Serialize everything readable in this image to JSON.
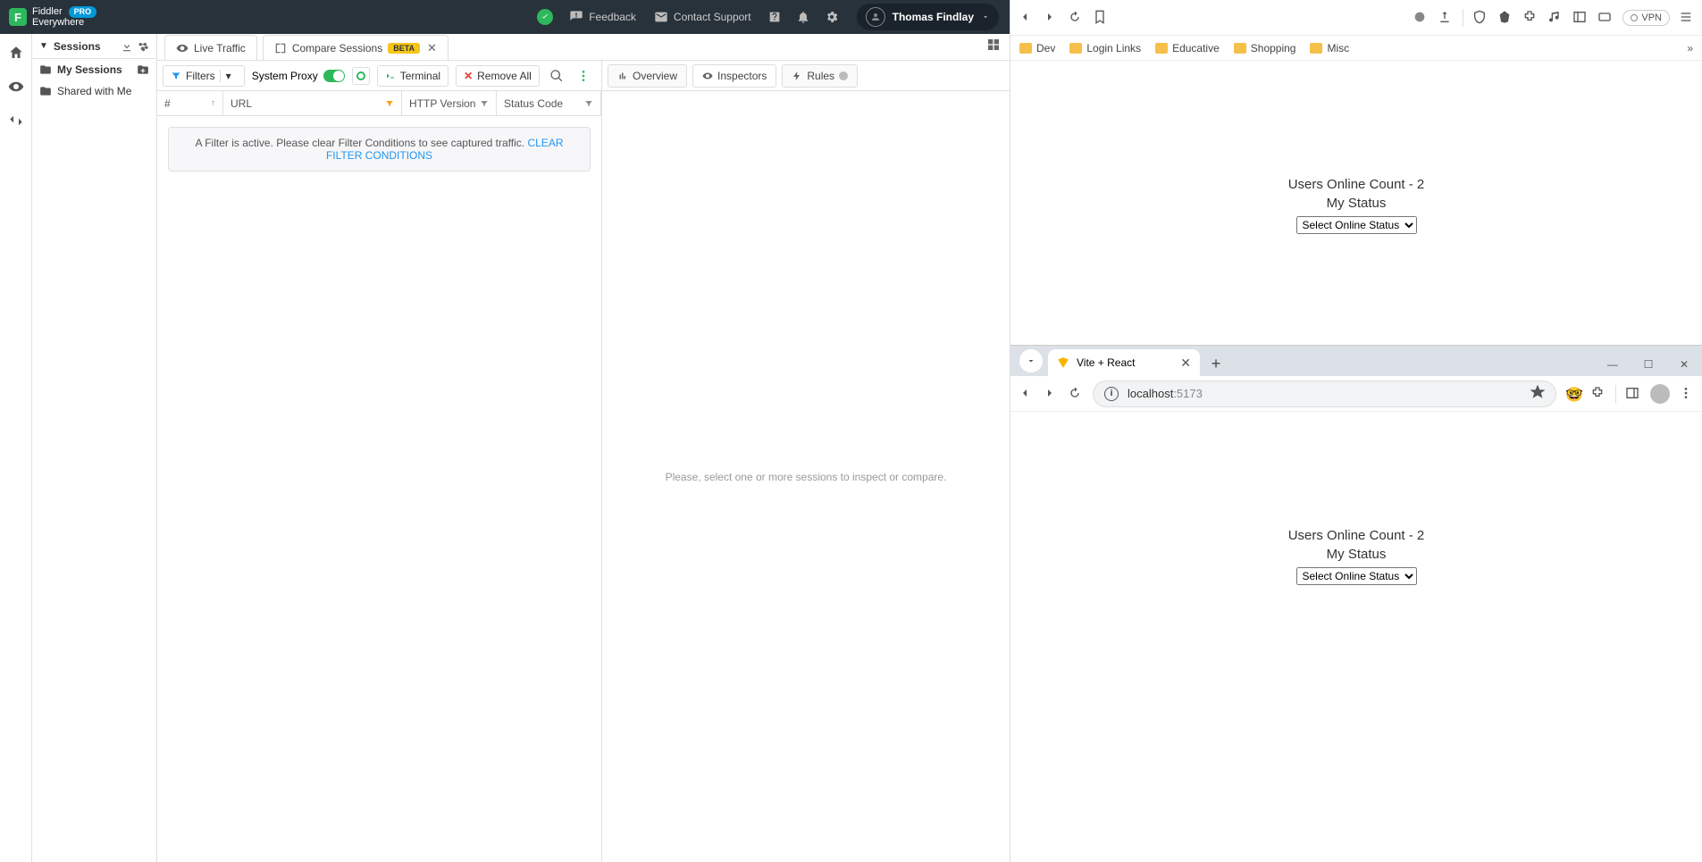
{
  "topbar": {
    "product_line1": "Fiddler",
    "product_line2": "Everywhere",
    "pro": "PRO",
    "feedback": "Feedback",
    "contact": "Contact Support",
    "user": "Thomas Findlay"
  },
  "sidebar": {
    "title": "Sessions",
    "my_sessions": "My Sessions",
    "shared": "Shared with Me"
  },
  "tabs": {
    "live": "Live Traffic",
    "compare": "Compare Sessions",
    "beta": "BETA"
  },
  "toolbar": {
    "filters": "Filters",
    "system_proxy": "System Proxy",
    "terminal": "Terminal",
    "remove_all": "Remove All"
  },
  "table": {
    "hash": "#",
    "url": "URL",
    "http": "HTTP Version",
    "status": "Status Code"
  },
  "banner": {
    "msg": "A Filter is active. Please clear Filter Conditions to see captured traffic. ",
    "link": "CLEAR FILTER CONDITIONS"
  },
  "rtabs": {
    "overview": "Overview",
    "inspectors": "Inspectors",
    "rules": "Rules"
  },
  "right_empty": "Please, select one or more sessions to inspect or compare.",
  "brave": {
    "vpn": "VPN",
    "bookmarks": [
      "Dev",
      "Login Links",
      "Educative",
      "Shopping",
      "Misc"
    ],
    "page_title": "Users Online Count - 2",
    "page_status": "My Status",
    "select": "Select Online Status"
  },
  "chrome": {
    "tab_title": "Vite + React",
    "url_host": "localhost",
    "url_port": ":5173",
    "page_title": "Users Online Count - 2",
    "page_status": "My Status",
    "select": "Select Online Status"
  }
}
